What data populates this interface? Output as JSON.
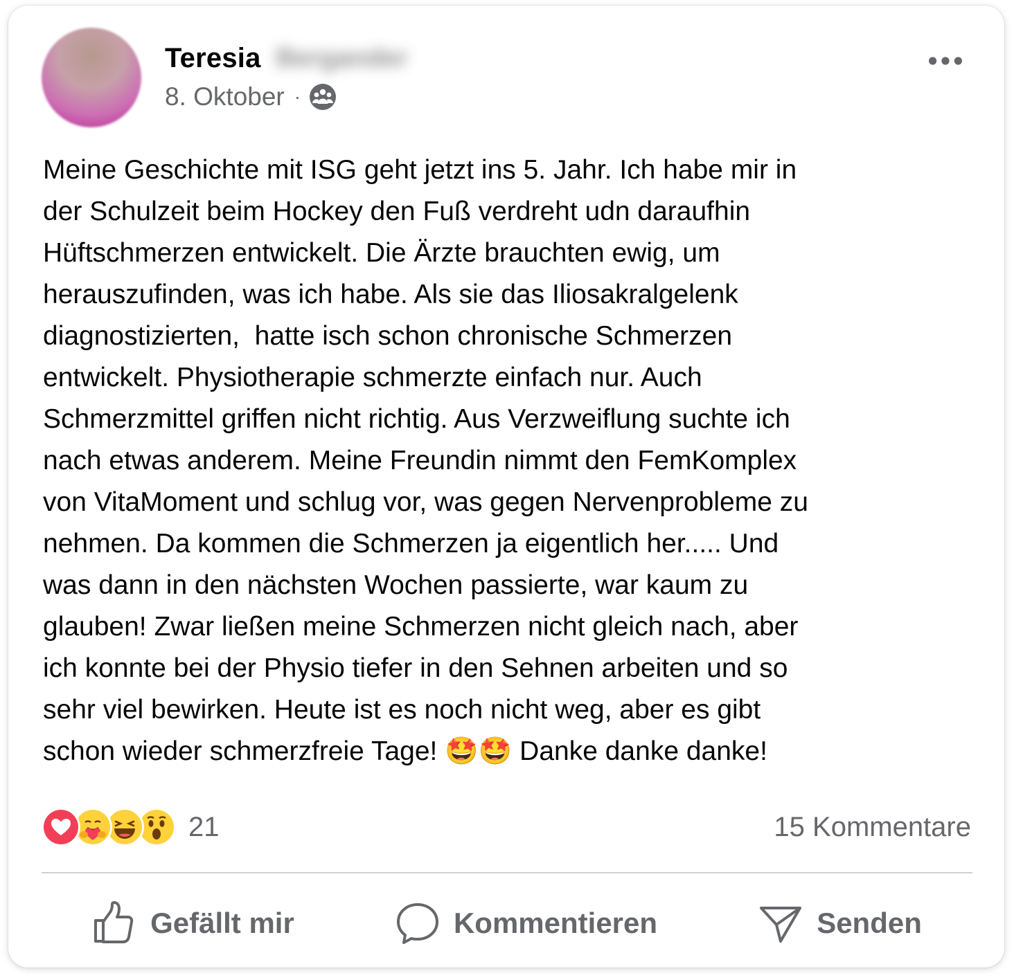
{
  "post": {
    "author_first_name": "Teresia",
    "author_last_name_redacted": "Bergander",
    "date": "8. Oktober",
    "separator": "·",
    "audience_icon": "group-icon",
    "more_icon": "more-options-icon",
    "text_lines": [
      "Meine Geschichte mit ISG geht jetzt ins 5. Jahr. Ich habe mir in",
      "der Schulzeit beim Hockey den Fuß verdreht udn daraufhin",
      "Hüftschmerzen entwickelt. Die Ärzte brauchten ewig, um",
      "herauszufinden, was ich habe. Als sie das Iliosakralgelenk",
      "diagnostizierten,  hatte isch schon chronische Schmerzen",
      "entwickelt. Physiotherapie schmerzte einfach nur. Auch",
      "Schmerzmittel griffen nicht richtig. Aus Verzweiflung suchte ich",
      "nach etwas anderem. Meine Freundin nimmt den FemKomplex",
      "von VitaMoment und schlug vor, was gegen Nervenprobleme zu",
      "nehmen. Da kommen die Schmerzen ja eigentlich her..... Und",
      "was dann in den nächsten Wochen passierte, war kaum zu",
      "glauben! Zwar ließen meine Schmerzen nicht gleich nach, aber",
      "ich konnte bei der Physio tiefer in den Sehnen arbeiten und so",
      "sehr viel bewirken. Heute ist es noch nicht weg, aber es gibt",
      "schon wieder schmerzfreie Tage! 🤩🤩 Danke danke danke!"
    ]
  },
  "stats": {
    "reactions": [
      "love-reaction-icon",
      "care-reaction-icon",
      "haha-reaction-icon",
      "wow-reaction-icon"
    ],
    "reaction_count": "21",
    "comments": "15 Kommentare"
  },
  "actions": {
    "like": {
      "label": "Gefällt mir",
      "icon": "thumbs-up-icon"
    },
    "comment": {
      "label": "Kommentieren",
      "icon": "comment-bubble-icon"
    },
    "share": {
      "label": "Senden",
      "icon": "send-icon"
    }
  },
  "colors": {
    "text_primary": "#050505",
    "text_secondary": "#65676b",
    "divider": "#ced0d4",
    "love_red": "#f33e58",
    "emoji_yellow": "#ffd23a"
  }
}
